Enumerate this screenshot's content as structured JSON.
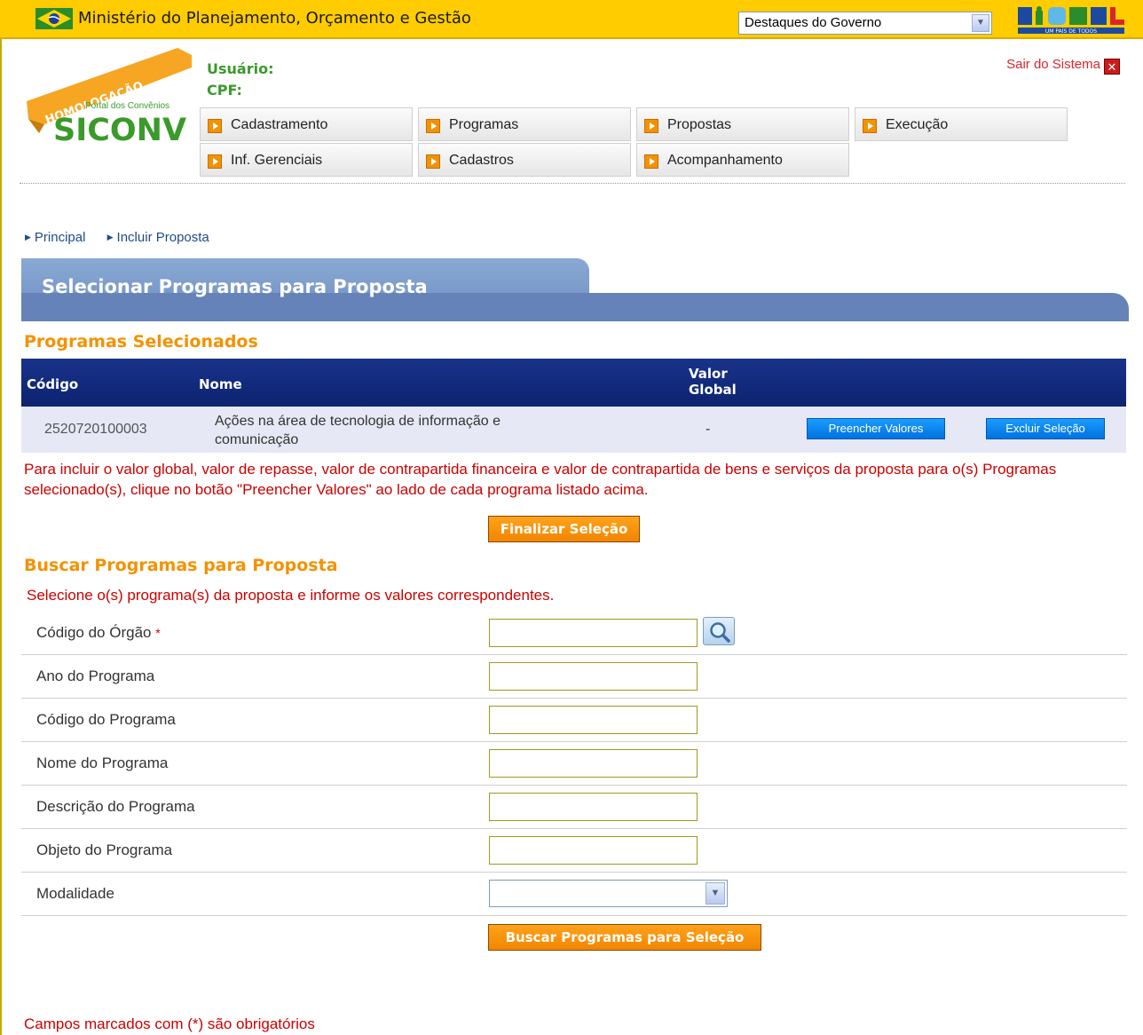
{
  "gov_bar": {
    "ministry": "Ministério do Planejamento, Orçamento e Gestão",
    "highlights_select": "Destaques do Governo",
    "brasil_logo_text": "BRASIL",
    "brasil_slogan": "UM PAÍS DE TODOS"
  },
  "header": {
    "badge": "HOMOLOGAÇÃO",
    "portal_subtitle": "Portal dos Convênios",
    "logo": "SICONV",
    "user_label": "Usuário:",
    "cpf_label": "CPF:",
    "logout": "Sair do Sistema",
    "logout_icon": "close-icon"
  },
  "menu": [
    {
      "label": "Cadastramento"
    },
    {
      "label": "Programas"
    },
    {
      "label": "Propostas"
    },
    {
      "label": "Execução"
    },
    {
      "label": "Inf. Gerenciais"
    },
    {
      "label": "Cadastros"
    },
    {
      "label": "Acompanhamento"
    }
  ],
  "breadcrumb": [
    "Principal",
    "Incluir Proposta"
  ],
  "page_title": "Selecionar Programas para Proposta",
  "selected": {
    "heading": "Programas Selecionados",
    "columns": {
      "code": "Código",
      "name": "Nome",
      "value_1": "Valor",
      "value_2": "Global"
    },
    "row": {
      "code": "2520720100003",
      "name_1": "Ações na área de tecnologia de informação e",
      "name_2": "comunicação",
      "value": "-",
      "fill_button": "Preencher Valores",
      "remove_button": "Excluir Seleção"
    },
    "note": "Para incluir o valor global, valor de repasse, valor de contrapartida financeira e valor de contrapartida de bens e serviços da proposta para o(s) Programas selecionado(s), clique no botão \"Preencher Valores\" ao lado de cada programa listado acima.",
    "finish_button": "Finalizar Seleção"
  },
  "search": {
    "heading": "Buscar Programas para Proposta",
    "instruction": "Selecione o(s) programa(s) da proposta e informe os valores correspondentes.",
    "fields": {
      "orgao": "Código do Órgão",
      "required_mark": "*",
      "ano": "Ano do Programa",
      "codigo": "Código do Programa",
      "nome": "Nome do Programa",
      "descricao": "Descrição do Programa",
      "objeto": "Objeto do Programa",
      "modalidade": "Modalidade"
    },
    "values": {
      "orgao": "",
      "ano": "",
      "codigo": "",
      "nome": "",
      "descricao": "",
      "objeto": "",
      "modalidade": ""
    },
    "search_button": "Buscar Programas para Seleção"
  },
  "footer_note": "Campos marcados com (*) são obrigatórios",
  "colors": {
    "gov_yellow": "#ffcc00",
    "accent_orange": "#f39200",
    "title_blue": "#6583b8",
    "table_head": "#0d2370",
    "alert_red": "#cc0000",
    "logo_green": "#3a9a2a"
  }
}
